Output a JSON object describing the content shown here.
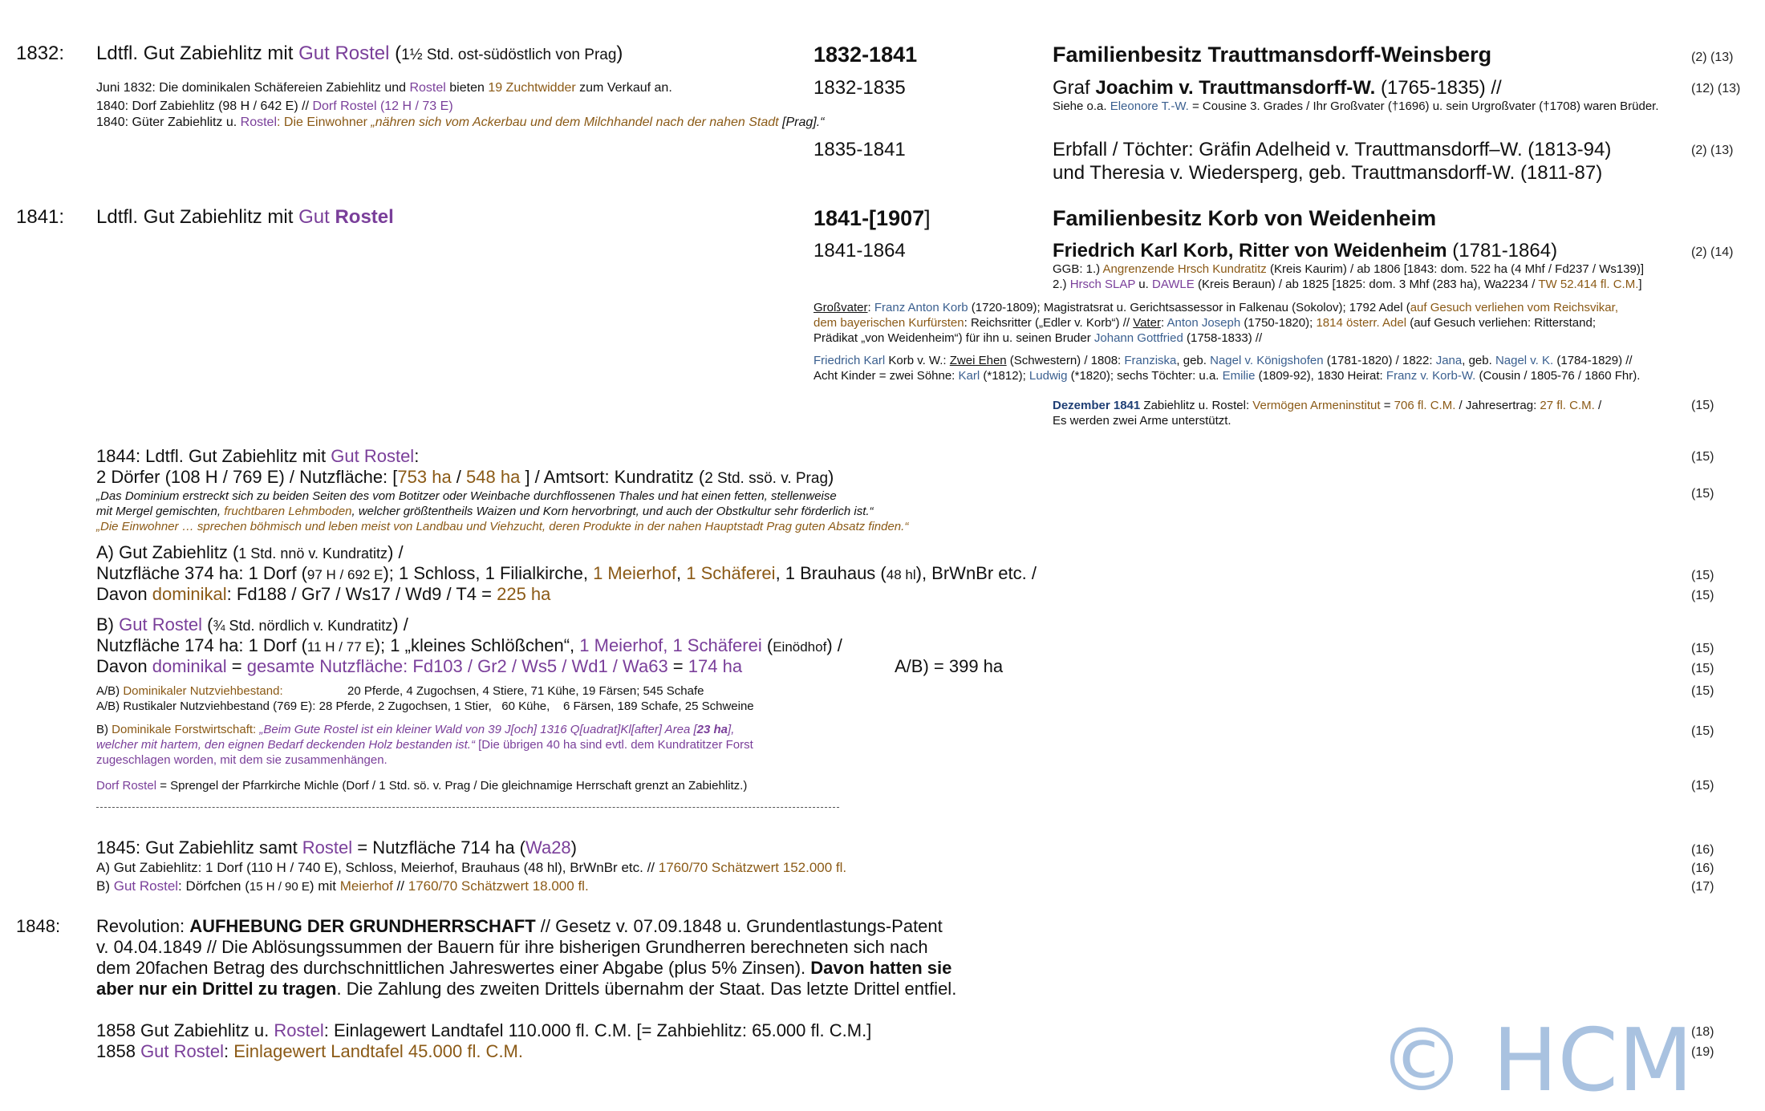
{
  "y1832": {
    "year": "1832:",
    "title_a": "Ldtfl. Gut Zabiehlitz mit ",
    "title_b": "Gut Rostel",
    "title_c": " (",
    "title_d": "1½ Std. ost-südöstlich von Prag",
    "title_e": ")",
    "n1_a": "Juni 1832: Die dominikalen Schäfereien Zabiehlitz und ",
    "n1_b": "Rostel",
    "n1_c": " bieten ",
    "n1_d": "19 Zuchtwidder",
    "n1_e": " zum Verkauf an.",
    "n2_a": "1840: Dorf Zabiehlitz (98 H / 642 E) // ",
    "n2_b": "Dorf Rostel",
    "n2_c": " (12 H / 73 E)",
    "n3_a": "1840: Güter Zabiehlitz u. ",
    "n3_b": "Rostel",
    "n3_c": ": Die Einwohner ",
    "n3_d": "„nähren sich vom Ackerbau und dem Milchhandel nach der nahen Stadt",
    "n3_e": " [Prag].“",
    "period_main": "1832-1841",
    "family_title": "Familienbesitz Trauttmansdorff-Weinsberg",
    "ref_main": "(2) (13)",
    "p1": "1832-1835",
    "owner1_a": "Graf ",
    "owner1_b": "Joachim v. Trauttmansdorff-W.",
    "owner1_c": " (1765-1835) //",
    "ref1": "(12) (13)",
    "note1_a": "Siehe o.a. ",
    "note1_b": "Eleonore T.-W.",
    "note1_c": " = Cousine 3. Grades / Ihr Großvater (†1696) u. sein Urgroßvater (†1708) waren Brüder.",
    "p2": "1835-1841",
    "owner2_l1": "Erbfall / Töchter: Gräfin Adelheid v. Trauttmansdorff–W. (1813-94)",
    "owner2_l2": "und Theresia v. Wiedersperg, geb. Trauttmansdorff-W. (1811-87)",
    "ref2": "(2) (13)"
  },
  "y1841": {
    "year": "1841:",
    "title_a": "Ldtfl. Gut Zabiehlitz mit ",
    "title_b": "Gut ",
    "title_c": "Rostel",
    "period_a": "1841-[",
    "period_b": "1907",
    "period_c": "]",
    "family_title": "Familienbesitz Korb von Weidenheim",
    "p1": "1841-1864",
    "owner_a": "Friedrich Karl Korb, Ritter von Weidenheim",
    "owner_b": " (1781-1864)",
    "ref1": "(2) (14)",
    "ggb1_a": "GGB: 1.) ",
    "ggb1_b": "Angrenzende Hrsch Kundratitz",
    "ggb1_c": " (Kreis Kaurim) / ab 1806 [1843: dom. 522 ha (4 Mhf / Fd237 / Ws139)]",
    "ggb2_a": "2.) ",
    "ggb2_b": "Hrsch SLAP",
    "ggb2_c": " u. ",
    "ggb2_d": "DAWLE",
    "ggb2_e": " (Kreis Beraun) / ab 1825 [1825: dom. 3 Mhf (283 ha), Wa2234 / ",
    "ggb2_f": "TW 52.414 fl. C.M.",
    "ggb2_g": "]",
    "gv1_a": "Großvater",
    "gv1_b": ": ",
    "gv1_c": "Franz Anton Korb",
    "gv1_d": " (1720-1809); Magistratsrat u. Gerichtsassessor in Falkenau (Sokolov); 1792 Adel (",
    "gv1_e": "auf Gesuch verliehen vom Reichsvikar,",
    "gv2_a": "dem bayerischen Kurfürsten",
    "gv2_b": ": Reichsritter („Edler v. Korb“) // ",
    "gv2_c": "Vater",
    "gv2_d": ": ",
    "gv2_e": "Anton Joseph",
    "gv2_f": " (1750-1820); ",
    "gv2_g": "1814 österr. Adel",
    "gv2_h": " (auf Gesuch verliehen: Ritterstand;",
    "gv3_a": "Prädikat „von Weidenheim“) für ihn u. seinen Bruder ",
    "gv3_b": "Johann Gottfried",
    "gv3_c": " (1758-1833) //",
    "fk1_a": "Friedrich Karl",
    "fk1_b": " Korb v. W.: ",
    "fk1_c": "Zwei Ehen",
    "fk1_d": " (Schwestern) / 1808: ",
    "fk1_e": "Franziska",
    "fk1_f": ", geb. ",
    "fk1_g": "Nagel v. Königshofen",
    "fk1_h": " (1781-1820) / 1822: ",
    "fk1_i": "Jana",
    "fk1_j": ", geb. ",
    "fk1_k": "Nagel v. K.",
    "fk1_l": " (1784-1829) //",
    "fk2_a": "Acht Kinder = zwei Söhne: ",
    "fk2_b": "Karl",
    "fk2_c": " (*1812); ",
    "fk2_d": "Ludwig",
    "fk2_e": " (*1820); sechs Töchter: u.a. ",
    "fk2_f": "Emilie",
    "fk2_g": " (1809-92), 1830 Heirat: ",
    "fk2_h": "Franz v. Korb-W.",
    "fk2_i": " (Cousin / 1805-76 / 1860 Fhr).",
    "dez1_a": "Dezember 1841",
    "dez1_b": " Zabiehlitz u. Rostel: ",
    "dez1_c": "Vermögen Armeninstitut",
    "dez1_d": " = ",
    "dez1_e": "706 fl. C.M.",
    "dez1_f": " / Jahresertrag: ",
    "dez1_g": "27 fl. C.M.",
    "dez1_h": " /",
    "dez2": "Es werden zwei Arme unterstützt.",
    "ref_dez": "(15)"
  },
  "y1844": {
    "l1_a": "1844: Ldtfl. Gut Zabiehlitz mit ",
    "l1_b": "Gut Rostel",
    "l1_c": ":",
    "ref_l1": "(15)",
    "l2_a": "2 Dörfer (108 H / 769 E) / Nutzfläche: [",
    "l2_b": "753 ha",
    "l2_c": " / ",
    "l2_d": "548 ha",
    "l2_e": " ] / Amtsort: Kundratitz (",
    "l2_f": "2 Std. ssö. v. Prag",
    "l2_g": ")",
    "q1_a": "„Das Dominium erstreckt sich zu beiden Seiten des vom Botitzer oder Weinbache durchflossenen Thales und hat einen fetten, stellenweise",
    "q2_a": "mit Mergel gemischten, ",
    "q2_b": "fruchtbaren Lehmboden",
    "q2_c": ", welcher größtentheils Waizen und Korn hervorbringt, und auch der Obstkultur sehr förderlich ist.“",
    "q3": "„Die Einwohner … sprechen böhmisch und leben meist von Landbau und Viehzucht, deren Produkte in der nahen Hauptstadt Prag guten Absatz finden.“",
    "ref_q": "(15)",
    "a_h_a": "A) Gut Zabiehlitz (",
    "a_h_b": "1 Std. nnö v. Kundratitz",
    "a_h_c": ") /",
    "a_l2_a": "Nutzfläche 374 ha: 1 Dorf (",
    "a_l2_b": "97 H / 692 E",
    "a_l2_c": "); 1 Schloss, 1 Filialkirche, ",
    "a_l2_d": "1 Meierhof",
    "a_l2_e": ", ",
    "a_l2_f": "1 Schäferei",
    "a_l2_g": ", 1 Brauhaus (",
    "a_l2_h": "48 hl",
    "a_l2_i": "), BrWnBr etc. /",
    "ref_a2": "(15)",
    "a_l3_a": "Davon ",
    "a_l3_b": "dominikal",
    "a_l3_c": ": Fd188 / Gr7 / Ws17 / Wd9 / T4 = ",
    "a_l3_d": "225 ha",
    "ref_a3": "(15)",
    "b_h_a": "B) ",
    "b_h_b": "Gut Rostel",
    "b_h_c": " (",
    "b_h_d": "¾ Std. nördlich v. Kundratitz",
    "b_h_e": ") /",
    "b_l2_a": "Nutzfläche 174 ha: 1 Dorf (",
    "b_l2_b": "11 H / 77 E",
    "b_l2_c": "); 1 „kleines Schlößchen“, ",
    "b_l2_d": "1 Meierhof",
    "b_l2_e": ", ",
    "b_l2_f": "1 Schäferei",
    "b_l2_g": " (",
    "b_l2_h": "Einödhof",
    "b_l2_i": ") /",
    "ref_b2": "(15)",
    "b_l3_a": "Davon ",
    "b_l3_b": "dominikal",
    "b_l3_c": " = ",
    "b_l3_d": "gesamte Nutzfläche: Fd103 / Gr2 / Ws5 / Wd1 / Wa63",
    "b_l3_e": " = ",
    "b_l3_f": "174 ha",
    "b_sum": "A/B) = 399 ha",
    "ref_b3": "(15)",
    "nv1_a": "A/B) ",
    "nv1_b": "Dominikaler Nutzviehbestand:",
    "nv1_c": "20 Pferde, 4 Zugochsen, 4 Stiere, 71 Kühe, 19 Färsen; 545 Schafe",
    "ref_nv1": "(15)",
    "nv2_a": "A/B) Rustikaler Nutzviehbestand (769 E): 28 Pferde, 2 Zugochsen, 1 Stier,   60 Kühe,    6 Färsen, 189 Schafe, 25 Schweine",
    "fw1_a": "B) ",
    "fw1_b": "Dominikale Forstwirtschaft: ",
    "fw1_c": "„Beim Gute Rostel ist ein kleiner Wald von 39 J[och] 1316 Q[uadrat]Kl[after] Area [",
    "fw1_d": "23 ha",
    "fw1_e": "],",
    "fw2_a": "welcher mit hartem, den eignen Bedarf deckenden Holz bestanden ist.“",
    "fw2_b": " [Die übrigen 40 ha sind evtl. dem Kundratitzer Forst",
    "fw3": "zugeschlagen worden, mit dem sie zusammenhängen.",
    "ref_fw": "(15)",
    "dr_a": "Dorf Rostel",
    "dr_b": " = Sprengel der Pfarrkirche Michle (Dorf / 1 Std. sö. v. Prag / Die gleichnamige Herrschaft grenzt an Zabiehlitz.)",
    "ref_dr": "(15)"
  },
  "y1845": {
    "l1_a": "1845: Gut Zabiehlitz samt ",
    "l1_b": "Rostel",
    "l1_c": " = Nutzfläche 714 ha (",
    "l1_d": "Wa28",
    "l1_e": ")",
    "ref1": "(16)",
    "l2_a": "A) Gut Zabiehlitz: 1 Dorf (110 H / 740 E), Schloss, Meierhof, Brauhaus (48 hl), BrWnBr etc. // ",
    "l2_b": "1760/70 Schätzwert 152.000 fl.",
    "ref2": "(16)",
    "l3_a": "B) ",
    "l3_b": "Gut Rostel",
    "l3_c": ": Dörfchen (",
    "l3_d": "15 H / 90 E",
    "l3_e": ") mit ",
    "l3_f": "Meierhof",
    "l3_g": " // ",
    "l3_h": "1760/70 Schätzwert 18.000 fl.",
    "ref3": "(17)"
  },
  "y1848": {
    "year": "1848:",
    "l1_a": "Revolution: ",
    "l1_b": "AUFHEBUNG DER GRUNDHERRSCHAFT",
    "l1_c": " // Gesetz v. 07.09.1848 u. Grundentlastungs-Patent",
    "l2": "v. 04.04.1849 // Die Ablösungssummen der Bauern für ihre bisherigen Grundherren berechneten sich nach",
    "l3_a": "dem 20fachen Betrag des durchschnittlichen Jahreswertes einer Abgabe (plus 5% Zinsen). ",
    "l3_b": "Davon hatten sie",
    "l4_a": "aber nur ein Drittel zu tragen",
    "l4_b": ". Die Zahlung des zweiten Drittels übernahm der Staat. Das letzte Drittel entfiel."
  },
  "y1858": {
    "l1_a": "1858 Gut Zabiehlitz u. ",
    "l1_b": "Rostel",
    "l1_c": ": Einlagewert Landtafel 110.000 fl. C.M. [= Zahbiehlitz: 65.000 fl. C.M.]",
    "ref1": "(18)",
    "l2_a": "1858 ",
    "l2_b": "Gut Rostel",
    "l2_c": ": ",
    "l2_d": "Einlagewert Landtafel 45.000 fl. C.M.",
    "ref2": "(19)"
  },
  "watermark": "© HCM",
  "colors": {
    "purple": "#7a3f9a",
    "brown": "#8b5a16",
    "blue": "#3a5f8f",
    "navy": "#1f3f75",
    "watermark": "#a9c2e0"
  }
}
